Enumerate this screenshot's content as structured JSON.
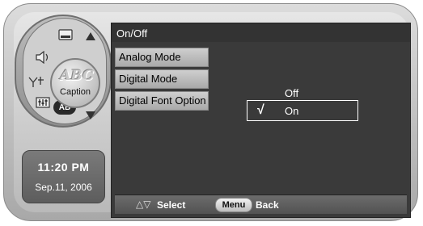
{
  "dial": {
    "center_label": "Caption",
    "center_art": "ABC",
    "ab_label": "AB",
    "icons": [
      "caption-window-icon",
      "speaker-icon",
      "antenna-icon",
      "equalizer-icon"
    ]
  },
  "clock": {
    "time": "11:20 PM",
    "date": "Sep.11, 2006"
  },
  "screen": {
    "title": "On/Off",
    "menu_items": [
      {
        "label": "Analog Mode"
      },
      {
        "label": "Digital Mode"
      },
      {
        "label": "Digital Font Option"
      }
    ],
    "options": {
      "off": "Off",
      "on": "On",
      "selected": "On",
      "check_glyph": "√"
    },
    "footer": {
      "select_glyphs": "△▽",
      "select_label": "Select",
      "menu_button": "Menu",
      "back_label": "Back"
    }
  }
}
